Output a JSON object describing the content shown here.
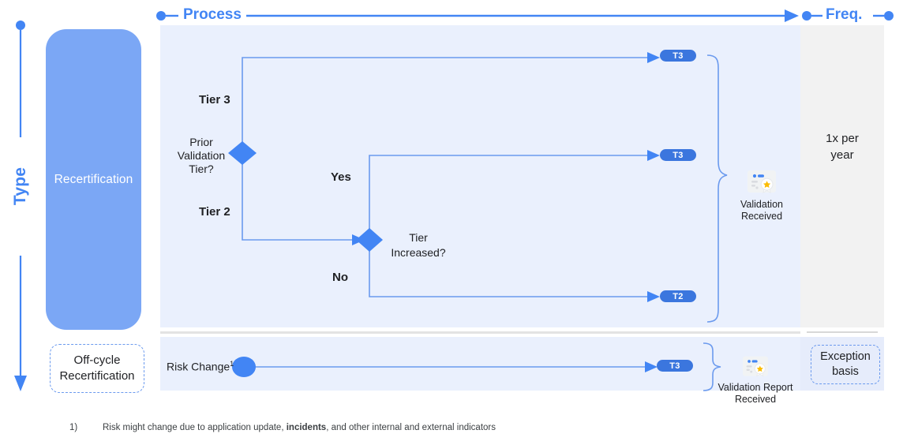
{
  "axes": {
    "vertical_label": "Type",
    "process_label": "Process",
    "freq_label": "Freq."
  },
  "swimlanes": [
    {
      "id": "recertification",
      "label": "Recertification",
      "style": "solid-blue"
    },
    {
      "id": "off-cycle",
      "label": "Off-cycle\nRecertification",
      "line1": "Off-cycle",
      "line2": "Recertification",
      "style": "dashed"
    }
  ],
  "frequency": {
    "main": {
      "line1": "1x per",
      "line2": "year"
    },
    "off_cycle": {
      "line1": "Exception",
      "line2": "basis"
    }
  },
  "flow": {
    "decision_1": {
      "name": "prior-validation-tier",
      "label_line1": "Prior",
      "label_line2": "Validation",
      "label_line3": "Tier?",
      "branch_up": "Tier 3",
      "branch_down": "Tier 2"
    },
    "decision_2": {
      "name": "tier-increased",
      "label_line1": "Tier",
      "label_line2": "Increased?",
      "branch_up": "Yes",
      "branch_down": "No"
    },
    "start_off_cycle": "Risk Change",
    "start_off_cycle_footnote_marker": "1"
  },
  "outcomes": [
    {
      "id": "t3-tier3-path",
      "pill": "T3"
    },
    {
      "id": "t3-yes-path",
      "pill": "T3"
    },
    {
      "id": "t2-no-path",
      "pill": "T2"
    },
    {
      "id": "t3-off-cycle",
      "pill": "T3"
    }
  ],
  "result_main": {
    "icon": "validation-badge-icon",
    "line1": "Validation",
    "line2": "Received"
  },
  "result_off_cycle": {
    "icon": "validation-badge-icon",
    "line1": "Validation Report",
    "line2": "Received"
  },
  "footnote": {
    "marker": "1)",
    "text_before": "Risk might change due to application update, ",
    "bold": "incidents",
    "text_after": ", and other internal and external indicators"
  },
  "colors": {
    "accent": "#4285f4",
    "lane_fill": "#7ba7f5",
    "panel_process": "#eaf0fd",
    "panel_freq": "#f2f2f2",
    "panel_freq_off": "#e6ecfb",
    "connector": "#6b9aee",
    "pill": "#3b76de",
    "diamond": "#4285f4"
  }
}
